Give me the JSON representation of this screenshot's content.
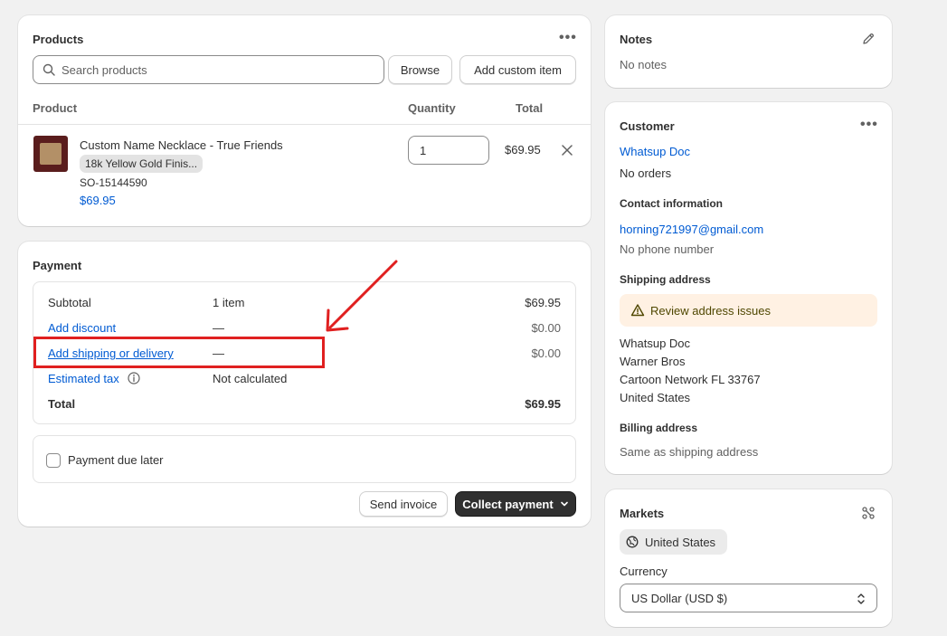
{
  "products": {
    "title": "Products",
    "search_placeholder": "Search products",
    "browse_label": "Browse",
    "add_custom_label": "Add custom item",
    "headers": {
      "product": "Product",
      "quantity": "Quantity",
      "total": "Total"
    },
    "item": {
      "name": "Custom Name Necklace - True Friends",
      "variant": "18k Yellow Gold Finis...",
      "sku": "SO-15144590",
      "price": "$69.95",
      "quantity": "1",
      "total": "$69.95"
    }
  },
  "payment": {
    "title": "Payment",
    "rows": [
      {
        "label": "Subtotal",
        "middle": "1 item",
        "amount": "$69.95"
      },
      {
        "label": "Add discount",
        "middle": "—",
        "amount": "$0.00"
      },
      {
        "label": "Add shipping or delivery",
        "middle": "—",
        "amount": "$0.00"
      },
      {
        "label": "Estimated tax",
        "middle": "Not calculated",
        "amount": ""
      },
      {
        "label": "Total",
        "middle": "",
        "amount": "$69.95"
      }
    ],
    "due_later_label": "Payment due later",
    "send_invoice_label": "Send invoice",
    "collect_payment_label": "Collect payment"
  },
  "notes": {
    "title": "Notes",
    "empty": "No notes"
  },
  "customer": {
    "title": "Customer",
    "name": "Whatsup Doc",
    "orders": "No orders",
    "contact_title": "Contact information",
    "email": "horning721997@gmail.com",
    "phone": "No phone number",
    "shipping_title": "Shipping address",
    "review_label": "Review address issues",
    "address": [
      "Whatsup Doc",
      "Warner Bros",
      "Cartoon Network FL 33767",
      "United States"
    ],
    "billing_title": "Billing address",
    "billing_value": "Same as shipping address"
  },
  "markets": {
    "title": "Markets",
    "market": "United States",
    "currency_label": "Currency",
    "currency_value": "US Dollar (USD $)"
  },
  "colors": {
    "accent_link": "#005bd3",
    "annotation": "#e02020",
    "primary_button": "#303030",
    "warning_bg": "#fff1e3"
  }
}
